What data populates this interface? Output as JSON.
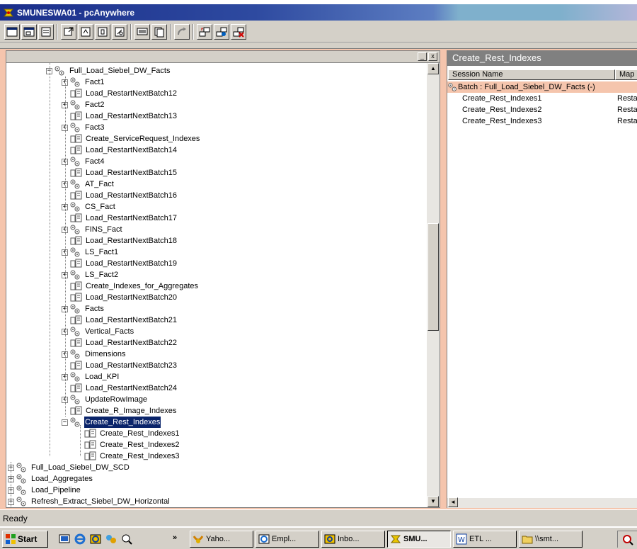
{
  "window": {
    "title": "SMUNESWA01 - pcAnywhere",
    "colors": {
      "title_start": "#1a2e8a",
      "selection": "#0a246a",
      "pane_bg": "#f5c5ad"
    }
  },
  "toolbar": {
    "icons": [
      "window-icon",
      "window-restore-icon",
      "properties-icon",
      "move-icon",
      "refresh-icon",
      "info-icon",
      "cut-icon",
      "monitor-icon",
      "copy-icon",
      "paste-icon",
      "transfer-icon",
      "connect-icon",
      "disconnect-icon"
    ]
  },
  "tree": {
    "nodes": [
      {
        "label": "Full_Load_Siebel_DW_Facts",
        "type": "batch",
        "level": 0,
        "expander": "−"
      },
      {
        "label": "Fact1",
        "type": "batch",
        "level": 1,
        "expander": "+"
      },
      {
        "label": "Load_RestartNextBatch12",
        "type": "session",
        "level": 1
      },
      {
        "label": "Fact2",
        "type": "batch",
        "level": 1,
        "expander": "+"
      },
      {
        "label": "Load_RestartNextBatch13",
        "type": "session",
        "level": 1
      },
      {
        "label": "Fact3",
        "type": "batch",
        "level": 1,
        "expander": "+"
      },
      {
        "label": "Create_ServiceRequest_Indexes",
        "type": "session",
        "level": 1
      },
      {
        "label": "Load_RestartNextBatch14",
        "type": "session",
        "level": 1
      },
      {
        "label": "Fact4",
        "type": "batch",
        "level": 1,
        "expander": "+"
      },
      {
        "label": "Load_RestartNextBatch15",
        "type": "session",
        "level": 1
      },
      {
        "label": "AT_Fact",
        "type": "batch",
        "level": 1,
        "expander": "+"
      },
      {
        "label": "Load_RestartNextBatch16",
        "type": "session",
        "level": 1
      },
      {
        "label": "CS_Fact",
        "type": "batch",
        "level": 1,
        "expander": "+"
      },
      {
        "label": "Load_RestartNextBatch17",
        "type": "session",
        "level": 1
      },
      {
        "label": "FINS_Fact",
        "type": "batch",
        "level": 1,
        "expander": "+"
      },
      {
        "label": "Load_RestartNextBatch18",
        "type": "session",
        "level": 1
      },
      {
        "label": "LS_Fact1",
        "type": "batch",
        "level": 1,
        "expander": "+"
      },
      {
        "label": "Load_RestartNextBatch19",
        "type": "session",
        "level": 1
      },
      {
        "label": "LS_Fact2",
        "type": "batch",
        "level": 1,
        "expander": "+"
      },
      {
        "label": "Create_Indexes_for_Aggregates",
        "type": "session",
        "level": 1
      },
      {
        "label": "Load_RestartNextBatch20",
        "type": "session",
        "level": 1
      },
      {
        "label": "Facts",
        "type": "batch",
        "level": 1,
        "expander": "+"
      },
      {
        "label": "Load_RestartNextBatch21",
        "type": "session",
        "level": 1
      },
      {
        "label": "Vertical_Facts",
        "type": "batch",
        "level": 1,
        "expander": "+"
      },
      {
        "label": "Load_RestartNextBatch22",
        "type": "session",
        "level": 1
      },
      {
        "label": "Dimensions",
        "type": "batch",
        "level": 1,
        "expander": "+"
      },
      {
        "label": "Load_RestartNextBatch23",
        "type": "session",
        "level": 1
      },
      {
        "label": "Load_KPI",
        "type": "batch",
        "level": 1,
        "expander": "+"
      },
      {
        "label": "Load_RestartNextBatch24",
        "type": "session",
        "level": 1
      },
      {
        "label": "UpdateRowImage",
        "type": "batch",
        "level": 1,
        "expander": "+"
      },
      {
        "label": "Create_R_Image_Indexes",
        "type": "session",
        "level": 1
      },
      {
        "label": "Create_Rest_Indexes",
        "type": "batch",
        "level": 1,
        "expander": "−",
        "selected": true
      },
      {
        "label": "Create_Rest_Indexes1",
        "type": "session",
        "level": 2
      },
      {
        "label": "Create_Rest_Indexes2",
        "type": "session",
        "level": 2
      },
      {
        "label": "Create_Rest_Indexes3",
        "type": "session",
        "level": 2
      },
      {
        "label": "Full_Load_Siebel_DW_SCD",
        "type": "batch",
        "level": -1,
        "expander": "+"
      },
      {
        "label": "Load_Aggregates",
        "type": "batch",
        "level": -1,
        "expander": "+"
      },
      {
        "label": "Load_Pipeline",
        "type": "batch",
        "level": -1,
        "expander": "+"
      },
      {
        "label": "Refresh_Extract_Siebel_DW_Horizontal",
        "type": "batch",
        "level": -1,
        "expander": "+"
      }
    ]
  },
  "right_pane": {
    "title": "Create_Rest_Indexes",
    "columns": [
      "Session Name",
      "Map"
    ],
    "group_row": "Batch : Full_Load_Siebel_DW_Facts (-)",
    "rows": [
      {
        "name": "Create_Rest_Indexes1",
        "map": "Resta"
      },
      {
        "name": "Create_Rest_Indexes2",
        "map": "Resta"
      },
      {
        "name": "Create_Rest_Indexes3",
        "map": "Resta"
      }
    ]
  },
  "status": {
    "text": "Ready"
  },
  "taskbar": {
    "start_label": "Start",
    "overflow_label": "»",
    "tasks": [
      {
        "label": "Yaho...",
        "icon": "yahoo-icon",
        "active": false
      },
      {
        "label": "Empl...",
        "icon": "browser-icon",
        "active": false
      },
      {
        "label": "Inbo...",
        "icon": "mail-icon",
        "active": false
      },
      {
        "label": "SMU...",
        "icon": "pcanywhere-icon",
        "active": true
      },
      {
        "label": "ETL ...",
        "icon": "word-icon",
        "active": false
      },
      {
        "label": "\\\\smt...",
        "icon": "folder-icon",
        "active": false
      }
    ]
  }
}
